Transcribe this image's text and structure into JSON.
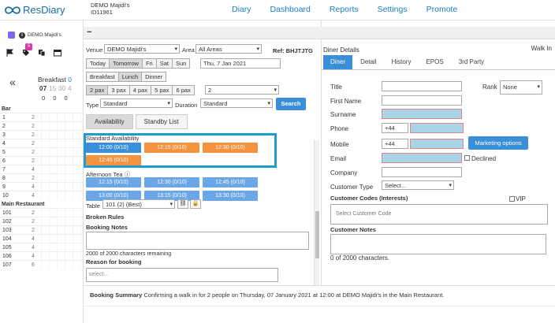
{
  "app": {
    "logo_text": "ResDiary",
    "venue_name": "DEMO Majidi's",
    "venue_id": "ID11961"
  },
  "nav": [
    {
      "label": "Diary"
    },
    {
      "label": "Dashboard"
    },
    {
      "label": "Reports"
    },
    {
      "label": "Settings"
    },
    {
      "label": "Promote"
    }
  ],
  "sidebar": {
    "venue_label": "DEMO Majidi's",
    "badge_count": "5",
    "collapse_glyph": "«",
    "service_label": "Breakfast",
    "service_extra": "0",
    "times": [
      "07",
      "15",
      "30",
      "4"
    ],
    "counts": [
      "0",
      "0",
      "0"
    ],
    "sections": [
      {
        "name": "Bar",
        "tables": [
          {
            "num": "1",
            "cap": "2"
          },
          {
            "num": "2",
            "cap": "2"
          },
          {
            "num": "3",
            "cap": "2"
          },
          {
            "num": "4",
            "cap": "2"
          },
          {
            "num": "5",
            "cap": "2"
          },
          {
            "num": "6",
            "cap": "2"
          },
          {
            "num": "7",
            "cap": "4"
          },
          {
            "num": "8",
            "cap": "2"
          },
          {
            "num": "9",
            "cap": "4"
          },
          {
            "num": "10",
            "cap": "4"
          }
        ]
      },
      {
        "name": "Main Restaurant",
        "tables": [
          {
            "num": "101",
            "cap": "2"
          },
          {
            "num": "102",
            "cap": "2"
          },
          {
            "num": "103",
            "cap": "2"
          },
          {
            "num": "104",
            "cap": "4"
          },
          {
            "num": "105",
            "cap": "4"
          },
          {
            "num": "106",
            "cap": "4"
          },
          {
            "num": "107",
            "cap": "6"
          }
        ]
      }
    ]
  },
  "center": {
    "header_symbol": "−",
    "venue_label": "Venue",
    "venue_value": "DEMO Majidi's",
    "area_label": "Area",
    "area_value": "All Areas",
    "ref": "Ref: BHJTJTG",
    "day_buttons": [
      "Today",
      "Tomorrow",
      "Fri",
      "Sat",
      "Sun"
    ],
    "date_value": "Thu, 7 Jan 2021",
    "service_buttons": [
      "Breakfast",
      "Lunch",
      "Dinner"
    ],
    "pax_buttons": [
      "2 pax",
      "3 pax",
      "4 pax",
      "5 pax",
      "6 pax"
    ],
    "pax_value": "2",
    "type_label": "Type",
    "type_value": "Standard",
    "duration_label": "Duration",
    "duration_value": "Standard",
    "search_label": "Search",
    "tabs": [
      "Availability",
      "Standby List"
    ],
    "standard_title": "Standard Availability",
    "standard_slots": [
      "12:00 (0/10)",
      "12:15 (0/10)",
      "12:30 (0/10)",
      "12:45 (0/10)"
    ],
    "afternoon_title": "Afternoon Tea ⓘ",
    "afternoon_slots": [
      "12:15 (0/10)",
      "12:30 (0/10)",
      "12:45 (0/10)",
      "13:00 (0/10)",
      "13:15 (0/10)",
      "13:30 (0/10)"
    ],
    "table_label": "Table",
    "table_value": "101 (2) (Best)",
    "broken_rules": "Broken Rules",
    "booking_notes": "Booking Notes",
    "chars_remaining": "2000 of 2000 characters remaining",
    "reason_label": "Reason for booking",
    "reason_placeholder": "select..."
  },
  "right": {
    "title": "Diner Details",
    "walk_in": "Walk In",
    "tabs": [
      "Diner",
      "Detail",
      "History",
      "EPOS",
      "3rd Party"
    ],
    "title_label": "Title",
    "rank_label": "Rank",
    "rank_value": "None",
    "first_name_label": "First Name",
    "surname_label": "Surname",
    "phone_label": "Phone",
    "phone_code": "+44",
    "mobile_label": "Mobile",
    "mobile_code": "+44",
    "marketing_label": "Marketing options",
    "email_label": "Email",
    "declined_label": "Declined",
    "company_label": "Company",
    "customer_type_label": "Customer Type",
    "customer_type_value": "Select...",
    "customer_codes_label": "Customer Codes (Interests)",
    "vip_label": "VIP",
    "customer_code_placeholder": "Select Customer Code",
    "customer_notes_label": "Customer Notes",
    "notes_count": "0 of 2000 characters."
  },
  "summary": {
    "label": "Booking Summary",
    "text": "Confirming a walk in for 2 people on Thursday, 07 January 2021 at 12:00 at DEMO Majidi's in the Main Restaurant."
  },
  "colors": {
    "accent": "#3b8fd9",
    "orange": "#f5923e",
    "highlight": "#1e9bd1",
    "badge": "#d63aa8",
    "venue": "#7b68ee"
  }
}
